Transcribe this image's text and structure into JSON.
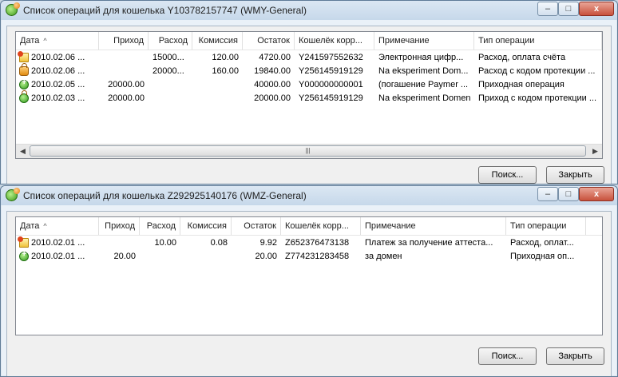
{
  "columns": {
    "date": "Дата",
    "income": "Приход",
    "expense": "Расход",
    "fee": "Комиссия",
    "balance": "Остаток",
    "counterparty": "Кошелёк корр...",
    "note": "Примечание",
    "type": "Тип операции"
  },
  "buttons": {
    "search": "Поиск...",
    "close": "Закрыть"
  },
  "window_controls": {
    "minimize": "–",
    "maximize": "□",
    "close": "x"
  },
  "windows": [
    {
      "title": "Список операций для кошелька Y103782157747 (WMY-General)",
      "rows": [
        {
          "icon": "invoice-expense-icon",
          "date": "2010.02.06 ...",
          "income": "",
          "expense": "15000...",
          "fee": "120.00",
          "balance": "4720.00",
          "counterparty": "Y241597552632",
          "note": "Электронная  цифр...",
          "type": "Расход, оплата счёта"
        },
        {
          "icon": "protected-expense-icon",
          "date": "2010.02.06 ...",
          "income": "",
          "expense": "20000...",
          "fee": "160.00",
          "balance": "19840.00",
          "counterparty": "Y256145919129",
          "note": "Na eksperiment Dom...",
          "type": "Расход с кодом протекции ..."
        },
        {
          "icon": "income-icon",
          "date": "2010.02.05 ...",
          "income": "20000.00",
          "expense": "",
          "fee": "",
          "balance": "40000.00",
          "counterparty": "Y000000000001",
          "note": "(погашение Paymer ...",
          "type": "Приходная операция"
        },
        {
          "icon": "protected-income-icon",
          "date": "2010.02.03 ...",
          "income": "20000.00",
          "expense": "",
          "fee": "",
          "balance": "20000.00",
          "counterparty": "Y256145919129",
          "note": "Na eksperiment Domen",
          "type": "Приход с кодом протекции ..."
        }
      ]
    },
    {
      "title": "Список операций для кошелька Z292925140176 (WMZ-General)",
      "rows": [
        {
          "icon": "invoice-expense-icon",
          "date": "2010.02.01 ...",
          "income": "",
          "expense": "10.00",
          "fee": "0.08",
          "balance": "9.92",
          "counterparty": "Z652376473138",
          "note": "Платеж за получение аттеста...",
          "type": "Расход, оплат..."
        },
        {
          "icon": "income-icon",
          "date": "2010.02.01 ...",
          "income": "20.00",
          "expense": "",
          "fee": "",
          "balance": "20.00",
          "counterparty": "Z774231283458",
          "note": "за домен",
          "type": "Приходная оп..."
        }
      ]
    }
  ]
}
